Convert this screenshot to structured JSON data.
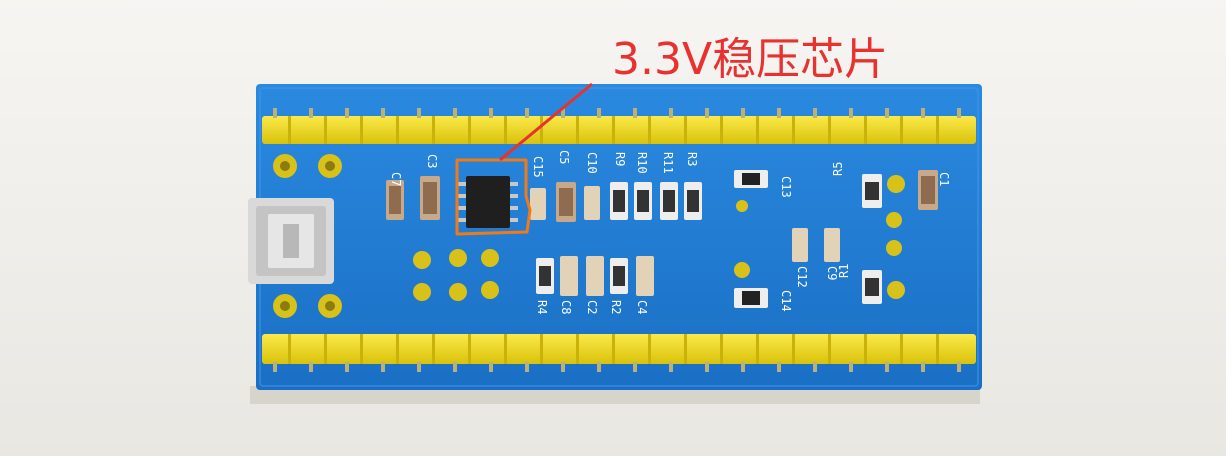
{
  "annotation": {
    "label": "3.3V稳压芯片",
    "color": "#e8322f",
    "box_color": "#f07a18"
  },
  "board": {
    "pcb_color": "#1f7fd6",
    "header_color": "#f2dc1c",
    "silkscreen_labels": [
      "C7",
      "C3",
      "C15",
      "C5",
      "C10",
      "R9",
      "R10",
      "R11",
      "R3",
      "C13",
      "R5",
      "C1",
      "C12",
      "C9",
      "R1",
      "C14",
      "R4",
      "C8",
      "C2",
      "R2",
      "C4"
    ]
  }
}
